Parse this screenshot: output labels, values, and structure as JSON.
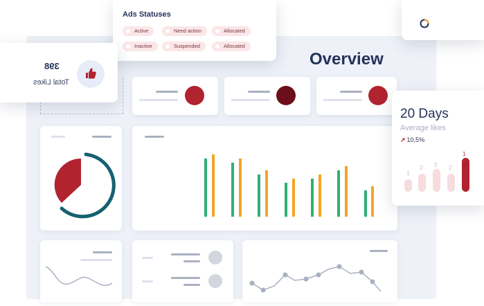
{
  "ads_statuses": {
    "title": "Ads Statuses",
    "chips": [
      "Active",
      "Need action",
      "Allocated",
      "Inactive",
      "Suspended",
      "Allocated"
    ]
  },
  "overview": {
    "title": "Overview"
  },
  "total_likes": {
    "value": "398",
    "label": "Total Likes",
    "icon": "thumbs-up-icon"
  },
  "days_card": {
    "title": "20 Days",
    "subtitle": "Average likes",
    "change": "10,5%",
    "bar_labels": [
      "1",
      "2",
      "2",
      "2",
      "1"
    ]
  },
  "colors": {
    "accent": "#b1232f",
    "dark_red": "#6b0f1a",
    "teal": "#166170",
    "green": "#2fb073",
    "orange": "#f2a623",
    "navy": "#24325a"
  }
}
